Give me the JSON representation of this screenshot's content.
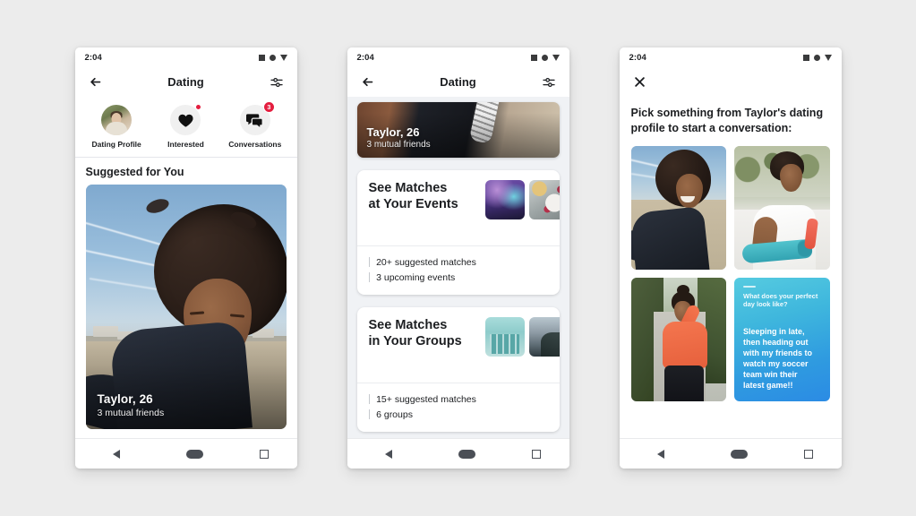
{
  "status_bar": {
    "time": "2:04",
    "icons": [
      "square-icon",
      "circle-icon",
      "triangle-down-icon"
    ]
  },
  "nav_bar": {
    "back": "back-triangle-icon",
    "home": "home-pill-icon",
    "recents": "recents-square-icon"
  },
  "screen1": {
    "header": {
      "back_icon": "back-arrow-icon",
      "title": "Dating",
      "settings_icon": "sliders-icon"
    },
    "shortcuts": [
      {
        "label": "Dating Profile",
        "icon": "profile-photo-icon",
        "badge": null
      },
      {
        "label": "Interested",
        "icon": "heart-icon",
        "badge": "dot"
      },
      {
        "label": "Conversations",
        "icon": "chat-bubbles-icon",
        "badge": "3"
      }
    ],
    "section_title": "Suggested for You",
    "suggested_card": {
      "name": "Taylor, 26",
      "subtitle": "3 mutual friends"
    }
  },
  "screen2": {
    "header": {
      "back_icon": "back-arrow-icon",
      "title": "Dating",
      "settings_icon": "sliders-icon"
    },
    "top_card": {
      "name": "Taylor, 26",
      "subtitle": "3 mutual friends"
    },
    "cards": [
      {
        "heading": "See Matches\nat Your Events",
        "thumbnails": [
          "galaxy-event-thumbnail",
          "food-event-thumbnail"
        ],
        "stats": [
          "20+ suggested matches",
          "3 upcoming events"
        ]
      },
      {
        "heading": "See Matches\nin Your Groups",
        "thumbnails": [
          "glass-building-group-thumbnail",
          "landscape-group-thumbnail"
        ],
        "stats": [
          "15+ suggested matches",
          "6 groups"
        ]
      }
    ]
  },
  "screen3": {
    "header": {
      "close_icon": "close-x-icon"
    },
    "prompt": "Pick something from Taylor's dating profile to start a conversation:",
    "tiles": [
      {
        "type": "photo",
        "name": "beach-selfie-photo"
      },
      {
        "type": "photo",
        "name": "yoga-mat-photo"
      },
      {
        "type": "photo",
        "name": "walking-orange-top-photo"
      },
      {
        "type": "prompt",
        "name": "prompt-answer-card",
        "question": "What does your perfect day look like?",
        "answer": "Sleeping in late, then heading out with my friends to watch my soccer team win their latest game!!"
      }
    ]
  },
  "colors": {
    "page_background": "#ececec",
    "surface": "#ffffff",
    "text_primary": "#1c1e21",
    "badge_red": "#e41e3f",
    "prompt_gradient_start": "#56cbe0",
    "prompt_gradient_end": "#2b8be4"
  }
}
